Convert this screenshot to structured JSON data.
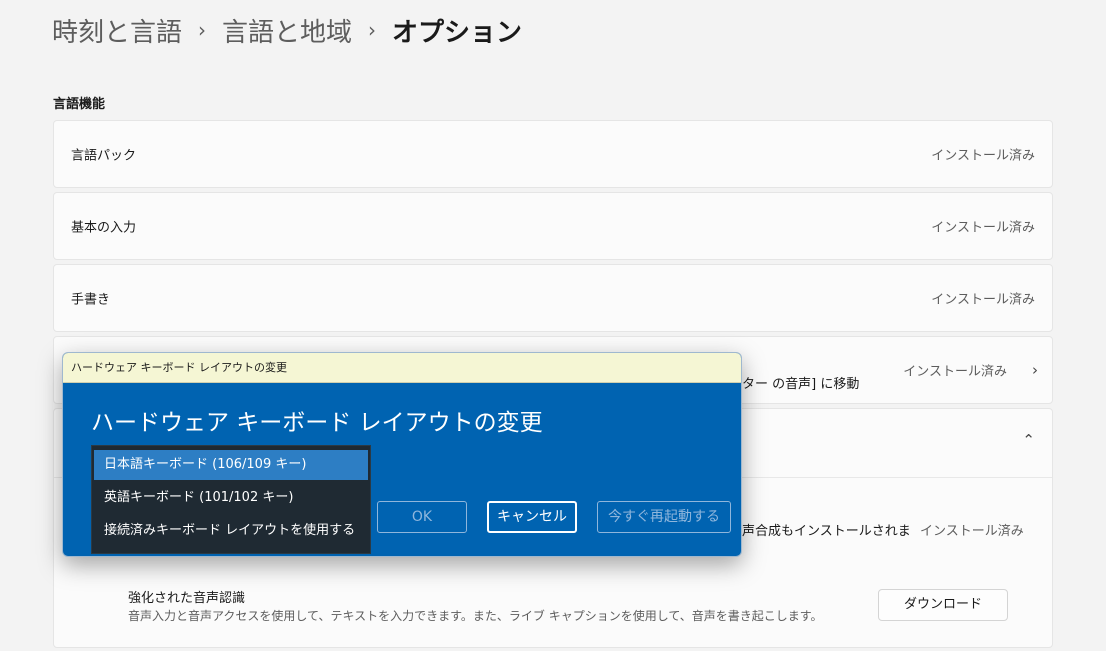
{
  "breadcrumb": {
    "items": [
      "時刻と言語",
      "言語と地域",
      "オプション"
    ],
    "separator": "›"
  },
  "section": {
    "title": "言語機能"
  },
  "features": [
    {
      "label": "言語パック",
      "status": "インストール済み"
    },
    {
      "label": "基本の入力",
      "status": "インストール済み"
    },
    {
      "label": "手書き",
      "status": "インストール済み"
    },
    {
      "label": "",
      "status": "インストール済み",
      "partial_text": "ター の音声] に移動"
    }
  ],
  "speech": {
    "partial_text": "声合成もインストールされま",
    "status": "インストール済み",
    "enhanced_title": "強化された音声認識",
    "enhanced_desc": "音声入力と音声アクセスを使用して、テキストを入力できます。また、ライブ キャプションを使用して、音声を書き起こします。",
    "download_label": "ダウンロード"
  },
  "dialog": {
    "titlebar": "ハードウェア キーボード レイアウトの変更",
    "heading": "ハードウェア キーボード レイアウトの変更",
    "options": [
      "日本語キーボード (106/109 キー)",
      "英語キーボード (101/102 キー)",
      "接続済みキーボード レイアウトを使用する"
    ],
    "selected_index": 0,
    "ok_label": "OK",
    "cancel_label": "キャンセル",
    "restart_label": "今すぐ再起動する"
  },
  "colors": {
    "dialog_bg": "#0063b1",
    "titlebar_bg": "#f5f6d4",
    "selected_item": "#2d7ec4",
    "page_bg": "#f3f3f3"
  },
  "icons": {
    "breadcrumb_separator": "chevron-right-icon",
    "card_expand": "chevron-right-icon",
    "card_collapse": "chevron-up-icon"
  }
}
